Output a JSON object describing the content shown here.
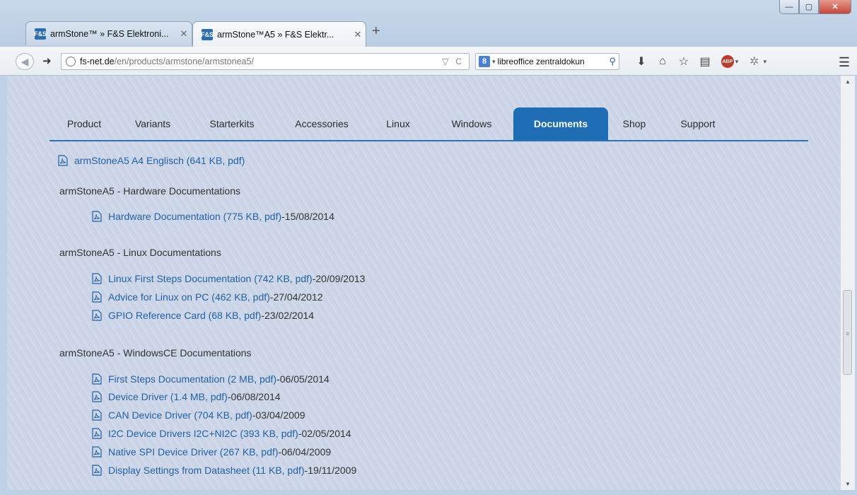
{
  "browser": {
    "tabs": [
      {
        "title": "armStone™ » F&S Elektroni...",
        "favicon": "F&S",
        "close": "✕"
      },
      {
        "title": "armStone™A5 » F&S Elektr...",
        "favicon": "F&S",
        "close": "✕"
      }
    ],
    "new_tab": "+",
    "window_buttons": {
      "minimize": "—",
      "maximize": "▢",
      "close": "✕"
    },
    "url": {
      "host": "fs-net.de",
      "path": "/en/products/armstone/armstonea5/"
    },
    "search": {
      "engine": "8",
      "value": "libreoffice zentraldokun"
    }
  },
  "page": {
    "tabs": [
      {
        "label": "Product",
        "width": 0
      },
      {
        "label": "Variants"
      },
      {
        "label": "Starterkits"
      },
      {
        "label": "Accessories"
      },
      {
        "label": "Linux"
      },
      {
        "label": "Windows"
      },
      {
        "label": "Documents",
        "active": true
      },
      {
        "label": "Shop"
      },
      {
        "label": "Support"
      }
    ],
    "top_doc": {
      "title": "armStoneA5 A4 Englisch (641 KB, pdf)"
    },
    "sections": [
      {
        "heading": "armStoneA5 - Hardware Documentations",
        "docs": [
          {
            "title": "Hardware Documentation (775 KB, pdf)",
            "date": "15/08/2014"
          }
        ]
      },
      {
        "heading": "armStoneA5 - Linux Documentations",
        "docs": [
          {
            "title": "Linux First Steps Documentation (742 KB, pdf)",
            "date": "20/09/2013"
          },
          {
            "title": "Advice for Linux on PC (462 KB, pdf)",
            "date": "27/04/2012"
          },
          {
            "title": "GPIO Reference Card (68 KB, pdf)",
            "date": "23/02/2014"
          }
        ]
      },
      {
        "heading": "armStoneA5 - WindowsCE Documentations",
        "docs": [
          {
            "title": "First Steps Documentation (2 MB, pdf)",
            "date": "06/05/2014"
          },
          {
            "title": "Device Driver (1.4 MB, pdf)",
            "date": "06/08/2014"
          },
          {
            "title": "CAN Device Driver (704 KB, pdf)",
            "date": "03/04/2009"
          },
          {
            "title": "I2C Device Drivers I2C+NI2C (393 KB, pdf)",
            "date": "02/05/2014"
          },
          {
            "title": "Native SPI Device Driver (267 KB, pdf)",
            "date": "06/04/2009"
          },
          {
            "title": "Display Settings from Datasheet (11 KB, pdf)",
            "date": "19/11/2009"
          }
        ]
      }
    ],
    "date_separator": " - "
  },
  "colors": {
    "accent": "#1f6db5",
    "link": "#2261a8"
  }
}
